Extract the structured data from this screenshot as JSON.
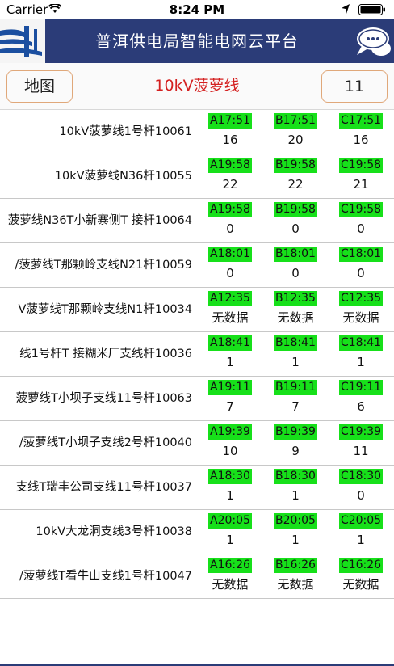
{
  "status": {
    "carrier": "Carrier",
    "time": "8:24 PM"
  },
  "header": {
    "title": "普洱供电局智能电网云平台"
  },
  "toolbar": {
    "map_label": "地图",
    "line_name": "10kV菠萝线",
    "count": "11"
  },
  "rows": [
    {
      "name": "10kV菠萝线1号杆10061",
      "a_time": "A17:51",
      "a_val": "16",
      "b_time": "B17:51",
      "b_val": "20",
      "c_time": "C17:51",
      "c_val": "16"
    },
    {
      "name": "10kV菠萝线N36杆10055",
      "a_time": "A19:58",
      "a_val": "22",
      "b_time": "B19:58",
      "b_val": "22",
      "c_time": "C19:58",
      "c_val": "21"
    },
    {
      "name": "菠萝线N36T小新寨侧T 接杆10064",
      "a_time": "A19:58",
      "a_val": "0",
      "b_time": "B19:58",
      "b_val": "0",
      "c_time": "C19:58",
      "c_val": "0"
    },
    {
      "name": "/菠萝线T那颗岭支线N21杆10059",
      "a_time": "A18:01",
      "a_val": "0",
      "b_time": "B18:01",
      "b_val": "0",
      "c_time": "C18:01",
      "c_val": "0"
    },
    {
      "name": "V菠萝线T那颗岭支线N1杆10034",
      "a_time": "A12:35",
      "a_val": "无数据",
      "b_time": "B12:35",
      "b_val": "无数据",
      "c_time": "C12:35",
      "c_val": "无数据"
    },
    {
      "name": "线1号杆T 接糊米厂支线杆10036",
      "a_time": "A18:41",
      "a_val": "1",
      "b_time": "B18:41",
      "b_val": "1",
      "c_time": "C18:41",
      "c_val": "1"
    },
    {
      "name": "菠萝线T小坝子支线11号杆10063",
      "a_time": "A19:11",
      "a_val": "7",
      "b_time": "B19:11",
      "b_val": "7",
      "c_time": "C19:11",
      "c_val": "6"
    },
    {
      "name": "/菠萝线T小坝子支线2号杆10040",
      "a_time": "A19:39",
      "a_val": "10",
      "b_time": "B19:39",
      "b_val": "9",
      "c_time": "C19:39",
      "c_val": "11"
    },
    {
      "name": "支线T瑞丰公司支线11号杆10037",
      "a_time": "A18:30",
      "a_val": "1",
      "b_time": "B18:30",
      "b_val": "1",
      "c_time": "C18:30",
      "c_val": "0"
    },
    {
      "name": "10kV大龙洞支线3号杆10038",
      "a_time": "A20:05",
      "a_val": "1",
      "b_time": "B20:05",
      "b_val": "1",
      "c_time": "C20:05",
      "c_val": "1"
    },
    {
      "name": "/菠萝线T看牛山支线1号杆10047",
      "a_time": "A16:26",
      "a_val": "无数据",
      "b_time": "B16:26",
      "b_val": "无数据",
      "c_time": "C16:26",
      "c_val": "无数据"
    }
  ]
}
